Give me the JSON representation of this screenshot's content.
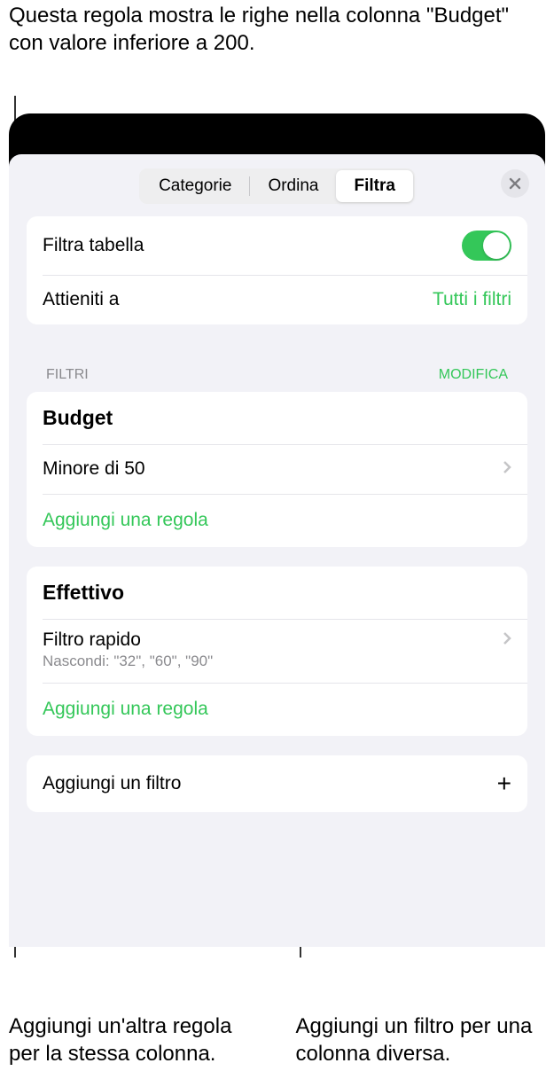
{
  "callouts": {
    "top": "Questa regola mostra le righe nella colonna \"Budget\" con valore inferiore a 200.",
    "bottom_left": "Aggiungi un'altra regola per la stessa colonna.",
    "bottom_right": "Aggiungi un filtro per una colonna diversa."
  },
  "tabs": {
    "categories": "Categorie",
    "sort": "Ordina",
    "filter": "Filtra"
  },
  "filter_table": {
    "label": "Filtra tabella",
    "on": true
  },
  "match": {
    "label": "Attieniti a",
    "value": "Tutti i filtri"
  },
  "section": {
    "title": "FILTRI",
    "edit": "MODIFICA"
  },
  "groups": [
    {
      "column": "Budget",
      "rule_text": "Minore di 50",
      "add_rule": "Aggiungi una regola"
    },
    {
      "column": "Effettivo",
      "rule_text": "Filtro rapido",
      "rule_detail": "Nascondi: \"32\", \"60\", \"90\"",
      "add_rule": "Aggiungi una regola"
    }
  ],
  "add_filter": "Aggiungi un filtro"
}
